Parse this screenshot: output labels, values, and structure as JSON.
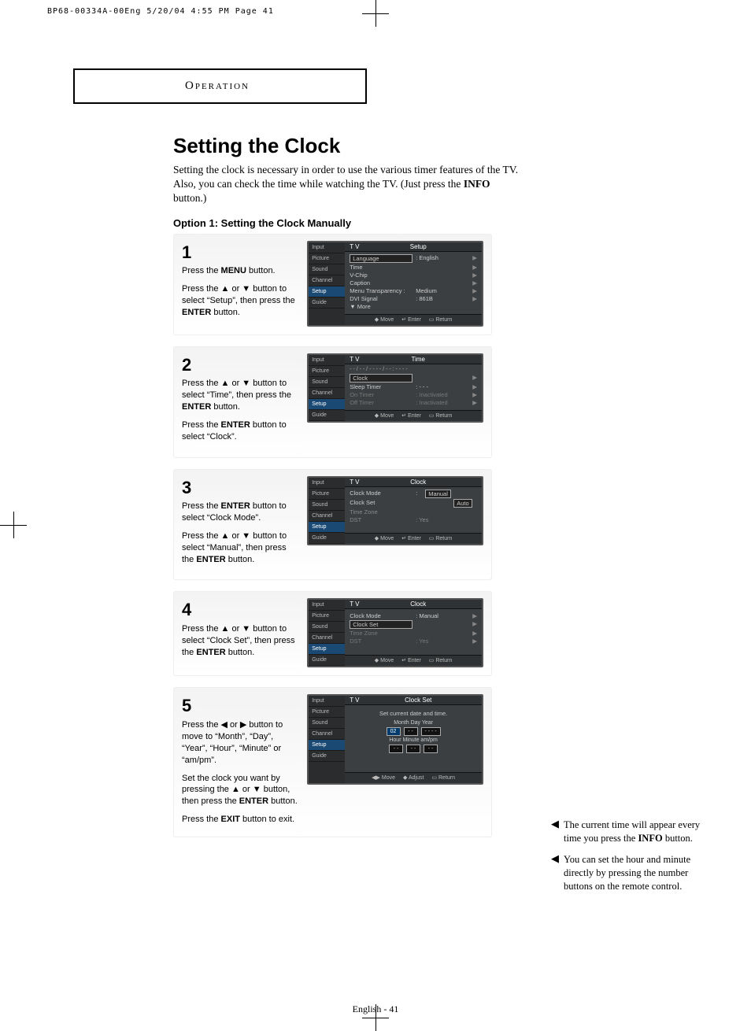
{
  "imposition_header": "BP68-00334A-00Eng  5/20/04  4:55 PM  Page 41",
  "chapter": "Operation",
  "page_footer": "English - 41",
  "title": "Setting the Clock",
  "intro_a": "Setting the clock is necessary in order to use the various timer features of the TV.  Also, you can check the time while watching the TV.  (Just press the ",
  "intro_b": "INFO",
  "intro_c": " button.)",
  "option_title": "Option 1: Setting the Clock Manually",
  "steps": {
    "s1": {
      "num": "1",
      "line1a": "Press the ",
      "line1b": "MENU",
      "line1c": " button.",
      "line2": "Press the ▲ or ▼ button to select “Setup”, then press the ",
      "line2b": "ENTER",
      "line2c": " button.",
      "ss": {
        "tv": "T V",
        "head": "Setup",
        "tabs": [
          "Input",
          "Picture",
          "Sound",
          "Channel",
          "Setup",
          "Guide"
        ],
        "rows": [
          {
            "lab": "Language",
            "val": ":   English",
            "arrow": "▶",
            "box": true
          },
          {
            "lab": "Time",
            "val": "",
            "arrow": "▶"
          },
          {
            "lab": "V-Chip",
            "val": "",
            "arrow": "▶"
          },
          {
            "lab": "Caption",
            "val": "",
            "arrow": "▶"
          },
          {
            "lab": "Menu Transparency :",
            "val": "Medium",
            "arrow": "▶"
          },
          {
            "lab": "DVI Signal",
            "val": ":   861B",
            "arrow": "▶"
          },
          {
            "lab": "▼ More",
            "val": "",
            "arrow": ""
          }
        ],
        "foot": [
          "Move",
          "Enter",
          "Return"
        ]
      }
    },
    "s2": {
      "num": "2",
      "line1": "Press the ▲ or ▼ button to select “Time”, then press the ",
      "line1b": "ENTER",
      "line1c": " button.",
      "line2a": "Press the ",
      "line2b": "ENTER",
      "line2c": " button to select “Clock”.",
      "ss": {
        "tv": "T V",
        "head": "Time",
        "date": "- - / - - / - - - - / - - : - -  - -",
        "tabs": [
          "Input",
          "Picture",
          "Sound",
          "Channel",
          "Setup",
          "Guide"
        ],
        "rows": [
          {
            "lab": "Clock",
            "val": "",
            "arrow": "▶",
            "box": true
          },
          {
            "lab": "Sleep Timer",
            "val": ":   - - -",
            "arrow": "▶"
          },
          {
            "lab": "On Timer",
            "val": ":   Inactivated",
            "arrow": "▶",
            "dim": true
          },
          {
            "lab": "Off Timer",
            "val": ":   Inactivated",
            "arrow": "▶",
            "dim": true
          }
        ],
        "foot": [
          "Move",
          "Enter",
          "Return"
        ]
      }
    },
    "s3": {
      "num": "3",
      "line1a": "Press the ",
      "line1b": "ENTER",
      "line1c": " button to select “Clock Mode”.",
      "line2": "Press the ▲ or ▼ button to select “Manual”, then press the ",
      "line2b": "ENTER",
      "line2c": " button.",
      "ss": {
        "tv": "T V",
        "head": "Clock",
        "tabs": [
          "Input",
          "Picture",
          "Sound",
          "Channel",
          "Setup",
          "Guide"
        ],
        "rows": [
          {
            "lab": "Clock Mode",
            "val": ":",
            "opts": [
              "Manual",
              "Auto"
            ]
          },
          {
            "lab": "Clock Set",
            "val": "",
            "arrow": ""
          },
          {
            "lab": "Time Zone",
            "val": "",
            "arrow": ""
          },
          {
            "lab": "DST",
            "val": ":   Yes",
            "arrow": ""
          }
        ],
        "foot": [
          "Move",
          "Enter",
          "Return"
        ]
      }
    },
    "s4": {
      "num": "4",
      "line1": "Press the ▲ or ▼ button to select “Clock Set”, then press the ",
      "line1b": "ENTER",
      "line1c": " button.",
      "ss": {
        "tv": "T V",
        "head": "Clock",
        "tabs": [
          "Input",
          "Picture",
          "Sound",
          "Channel",
          "Setup",
          "Guide"
        ],
        "rows": [
          {
            "lab": "Clock Mode",
            "val": ":   Manual",
            "arrow": "▶"
          },
          {
            "lab": "Clock Set",
            "val": "",
            "arrow": "▶",
            "box": true
          },
          {
            "lab": "Time Zone",
            "val": "",
            "arrow": "▶",
            "dim": true
          },
          {
            "lab": "DST",
            "val": ":   Yes",
            "arrow": "▶",
            "dim": true
          }
        ],
        "foot": [
          "Move",
          "Enter",
          "Return"
        ]
      }
    },
    "s5": {
      "num": "5",
      "line1": "Press the ◀ or ▶ button to move to “Month”, “Day”, “Year”, “Hour”, “Minute” or “am/pm”.",
      "line2": "Set the clock you want by pressing the ▲ or ▼ button, then press the ",
      "line2b": "ENTER",
      "line2c": " button.",
      "line3a": "Press the ",
      "line3b": "EXIT",
      "line3c": " button to exit.",
      "ss": {
        "tv": "T V",
        "head": "Clock Set",
        "prompt": "Set current date and time.",
        "tabs": [
          "Input",
          "Picture",
          "Sound",
          "Channel",
          "Setup",
          "Guide"
        ],
        "labels1": "Month   Day    Year",
        "vals1": [
          "02",
          "- -",
          "- - - -"
        ],
        "labels2": "Hour   Minute  am/pm",
        "vals2": [
          "- -",
          "- -",
          "- -"
        ],
        "foot": [
          "Move",
          "Adjust",
          "Return"
        ]
      }
    }
  },
  "notes": {
    "n1a": "The current time will appear every time you press the ",
    "n1b": "INFO",
    "n1c": " button.",
    "n2": "You can set the hour and minute directly by pressing the number buttons on the remote control."
  },
  "icons": {
    "updown": "◆",
    "enter": "↵",
    "return": "▭",
    "leftright": "◀▶"
  }
}
